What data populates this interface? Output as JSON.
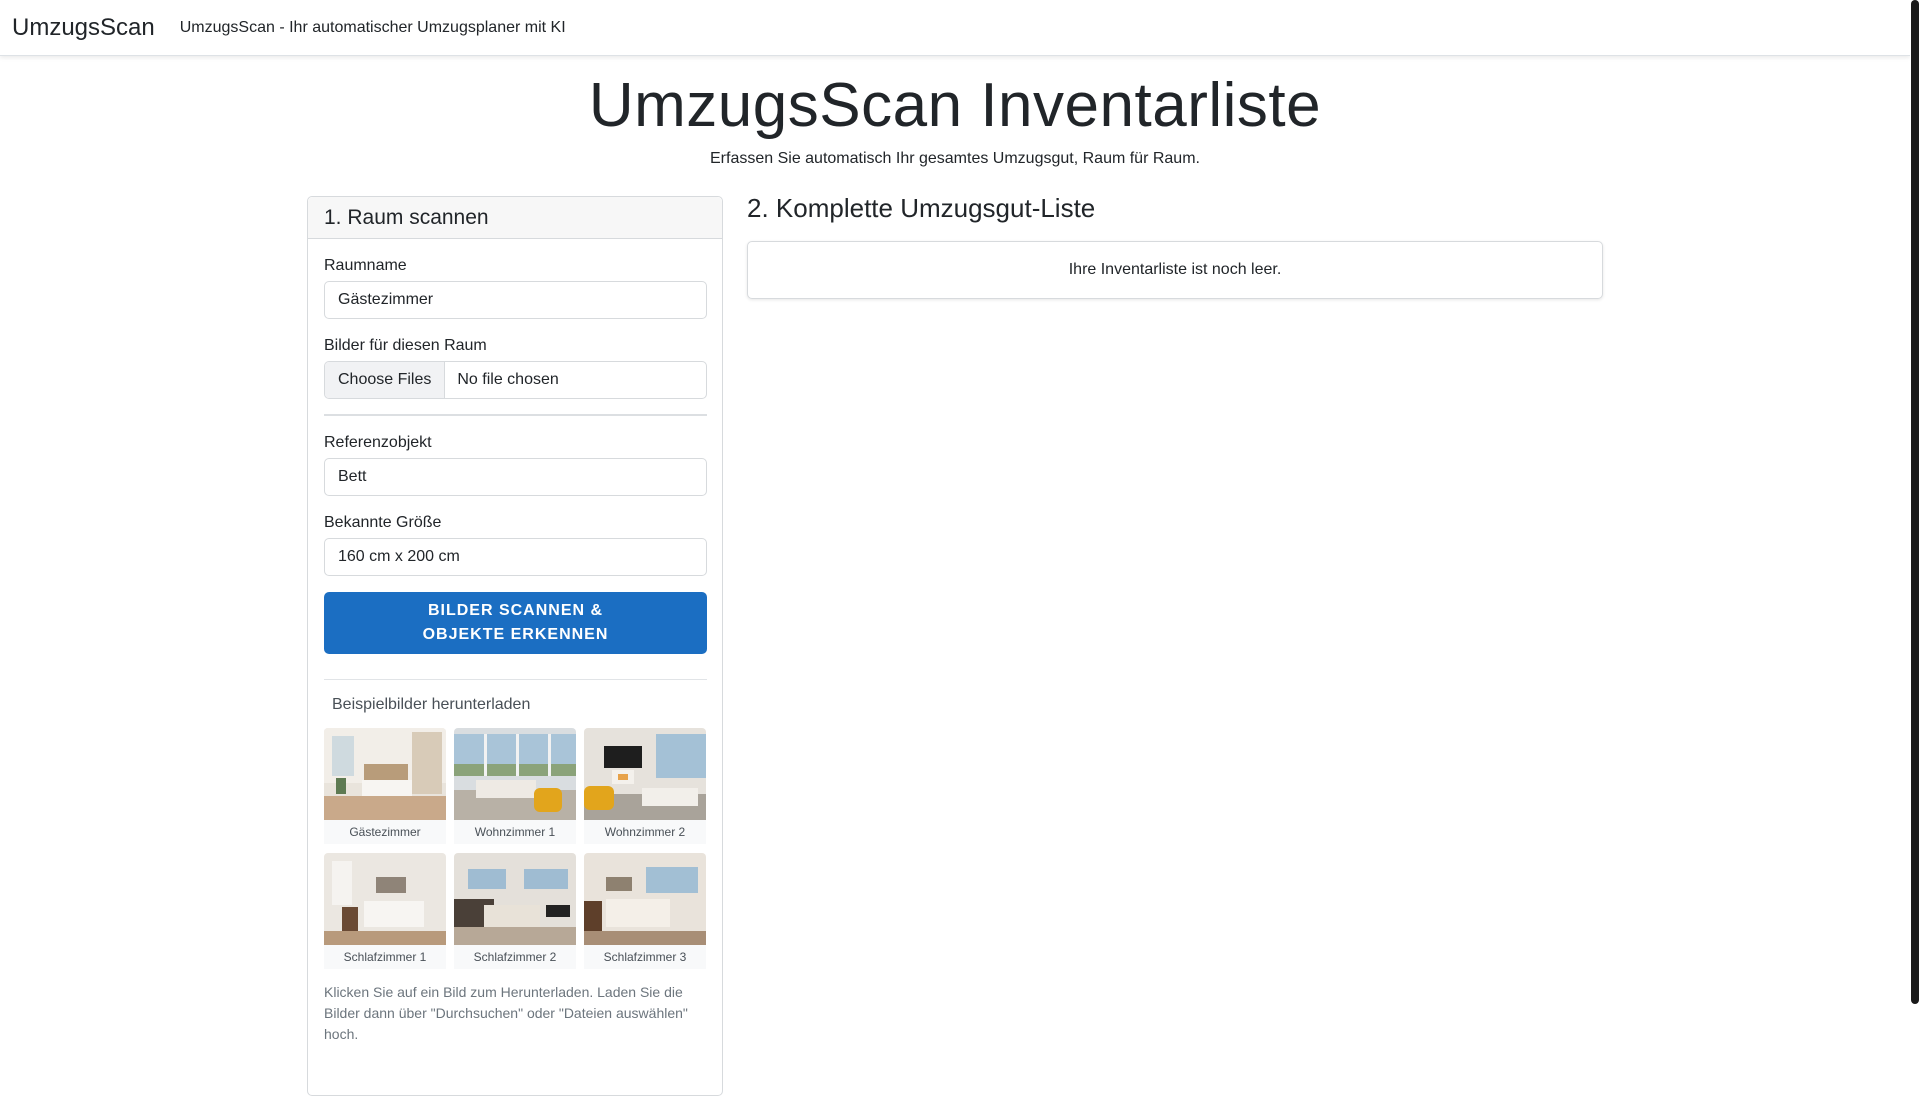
{
  "navbar": {
    "brand": "UmzugsScan",
    "tagline": "UmzugsScan - Ihr automatischer Umzugsplaner mit KI"
  },
  "page": {
    "title": "UmzugsScan Inventarliste",
    "subtitle": "Erfassen Sie automatisch Ihr gesamtes Umzugsgut, Raum für Raum."
  },
  "scan_card": {
    "header": "1. Raum scannen",
    "room_name_label": "Raumname",
    "room_name_value": "Gästezimmer",
    "images_label": "Bilder für diesen Raum",
    "file_button": "Choose Files",
    "file_status": "No file chosen",
    "reference_label": "Referenzobjekt",
    "reference_value": "Bett",
    "size_label": "Bekannte Größe",
    "size_value": "160 cm x 200 cm",
    "scan_button_line1": "BILDER SCANNEN &",
    "scan_button_line2": "OBJEKTE ERKENNEN",
    "download_title": "Beispielbilder herunterladen",
    "thumbnails": [
      {
        "caption": "Gästezimmer"
      },
      {
        "caption": "Wohnzimmer 1"
      },
      {
        "caption": "Wohnzimmer 2"
      },
      {
        "caption": "Schlafzimmer 1"
      },
      {
        "caption": "Schlafzimmer 2"
      },
      {
        "caption": "Schlafzimmer 3"
      }
    ],
    "hint": "Klicken Sie auf ein Bild zum Herunterladen. Laden Sie die Bilder dann über \"Durchsuchen\" oder \"Dateien auswählen\" hoch."
  },
  "inventory": {
    "title": "2. Komplette Umzugsgut-Liste",
    "empty_text": "Ihre Inventarliste ist noch leer."
  },
  "colors": {
    "primary": "#1b6ec2",
    "border": "#d7dadd"
  }
}
